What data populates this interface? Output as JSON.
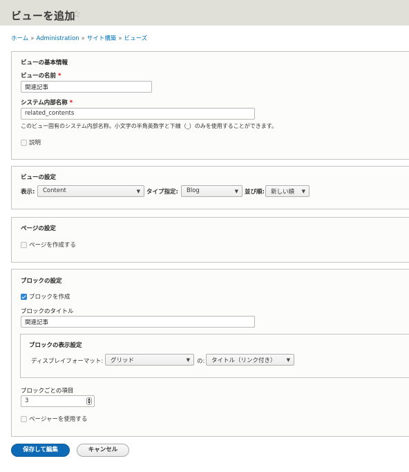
{
  "header": {
    "title": "ビューを追加",
    "star_icon": "star-outline-icon"
  },
  "breadcrumb": {
    "items": [
      "ホーム",
      "Administration",
      "サイト構築",
      "ビューズ"
    ],
    "separator": "»"
  },
  "basic_info": {
    "legend": "ビューの基本情報",
    "view_name_label": "ビューの名前",
    "view_name_value": "関連記事",
    "machine_name_label": "システム内部名称",
    "machine_name_value": "related_contents",
    "machine_name_description": "このビュー固有のシステム内部名称。小文字の半角英数字と下線（_）のみを使用することができます。",
    "description_checkbox_label": "説明",
    "description_checked": false,
    "required_mark": "*"
  },
  "view_settings": {
    "legend": "ビューの設定",
    "show_label": "表示:",
    "show_value": "Content",
    "type_label": "タイプ指定:",
    "type_value": "Blog",
    "sort_label": "並び順:",
    "sort_value": "新しい順"
  },
  "page_settings": {
    "legend": "ページの設定",
    "create_page_label": "ページを作成する",
    "create_page_checked": false
  },
  "block_settings": {
    "legend": "ブロックの設定",
    "create_block_label": "ブロックを作成",
    "create_block_checked": true,
    "block_title_label": "ブロックのタイトル",
    "block_title_value": "関連記事",
    "display": {
      "legend": "ブロックの表示設定",
      "format_label": "ディスプレイフォーマット:",
      "format_value": "グリッド",
      "of_label": "の:",
      "of_value": "タイトル（リンク付き）"
    },
    "items_per_block_label": "ブロックごとの項目",
    "items_per_block_value": "3",
    "use_pager_label": "ページャーを使用する",
    "use_pager_checked": false
  },
  "actions": {
    "save_label": "保存して編集",
    "cancel_label": "キャンセル"
  }
}
